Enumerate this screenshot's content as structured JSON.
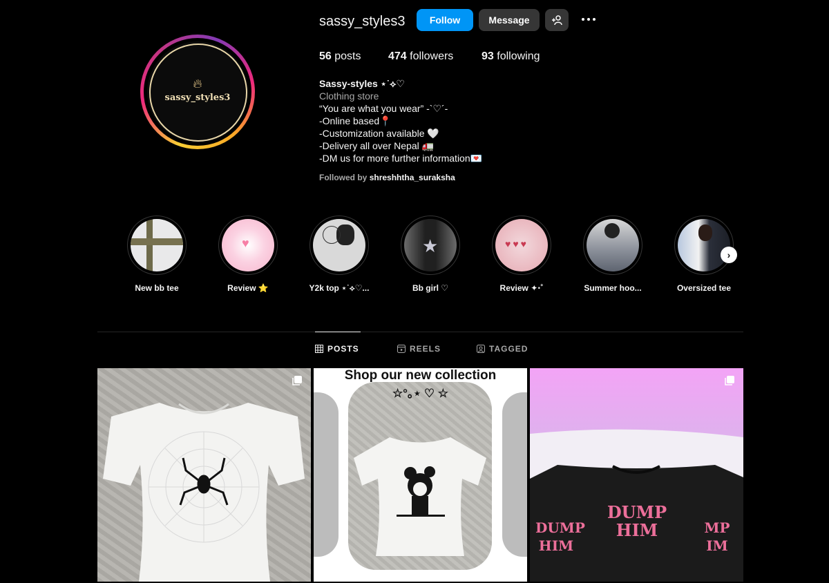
{
  "profile": {
    "username": "sassy_styles3",
    "avatar_text": "sassy_styles3",
    "follow_label": "Follow",
    "message_label": "Message",
    "stats": {
      "posts_count": "56",
      "posts_label": "posts",
      "followers_count": "474",
      "followers_label": "followers",
      "following_count": "93",
      "following_label": "following"
    },
    "bio": {
      "name": "Sassy-styles ⋆˙⟡♡",
      "category": "Clothing store",
      "lines": [
        "“You are what you wear” -`♡´-",
        "-Online based📍",
        "-Customization available 🤍",
        "-Delivery all over Nepal 🚛",
        "-DM us for more further information💌"
      ]
    },
    "followed_by_prefix": "Followed by",
    "followed_by_user": "shreshhtha_suraksha"
  },
  "highlights": [
    {
      "label": "New bb tee"
    },
    {
      "label": "Review ⭐"
    },
    {
      "label": "Y2k top ⋆˙⟡♡..."
    },
    {
      "label": "Bb girl ♡"
    },
    {
      "label": "Review ✦‧˚"
    },
    {
      "label": "Summer hoo..."
    },
    {
      "label": "Oversized tee"
    }
  ],
  "tabs": {
    "posts": "POSTS",
    "reels": "REELS",
    "tagged": "TAGGED"
  },
  "posts": {
    "post2_caption_line1": "Shop our  new collection",
    "post2_caption_line2": "☆°｡⋆ ♡ ☆",
    "post3_text_main": "DUMP HIM",
    "post3_text_left": "DUMP HIM",
    "post3_text_right": "MP IM"
  },
  "colors": {
    "background": "#000000",
    "follow_button": "#0095f6",
    "secondary_button": "#363636",
    "muted_text": "#a8a8a8"
  }
}
